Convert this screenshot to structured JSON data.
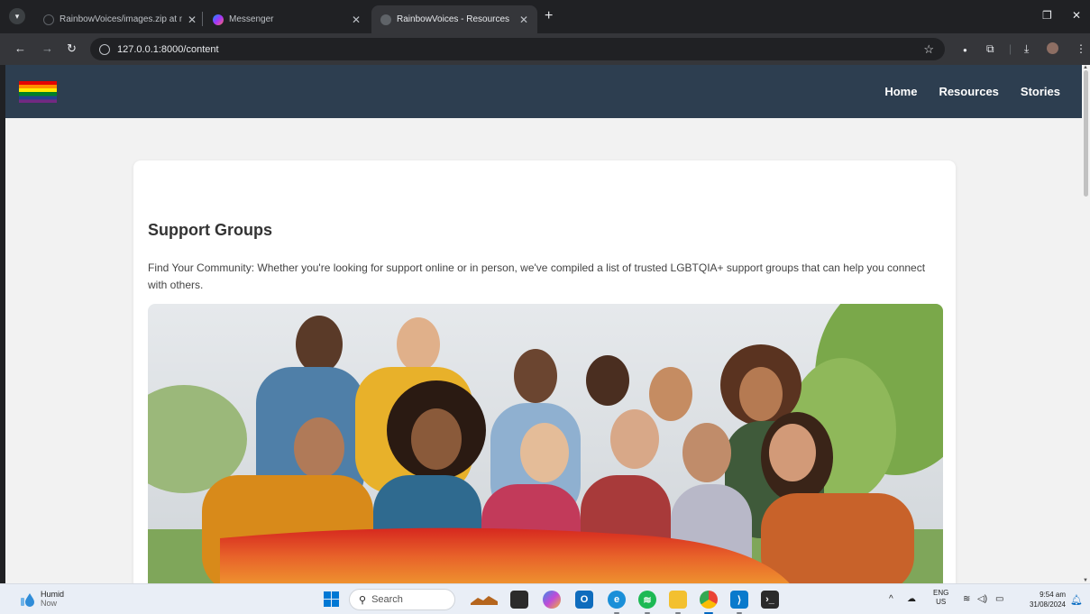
{
  "browser": {
    "tabs": [
      {
        "title": "RainbowVoices/images.zip at m",
        "active": false
      },
      {
        "title": "Messenger",
        "active": false
      },
      {
        "title": "RainbowVoices - Resources",
        "active": true
      }
    ],
    "url": "127.0.0.1:8000/content",
    "icons": [
      "tab-search-icon",
      "close-icon",
      "new-tab-icon",
      "minimize-icon",
      "restore-icon",
      "back-icon",
      "forward-icon",
      "reload-icon",
      "site-info-icon",
      "bookmark-star-icon",
      "extensions-icon",
      "downloads-icon",
      "profile-avatar",
      "menu-icon"
    ]
  },
  "site": {
    "nav": {
      "home": "Home",
      "resources": "Resources",
      "stories": "Stories"
    },
    "section": {
      "heading": "Support Groups",
      "text": "Find Your Community: Whether you're looking for support online or in person, we've compiled a list of trusted LGBTQIA+ support groups that can help you connect with others."
    },
    "colors": {
      "header_bg": "#2d3e50",
      "page_bg": "#f2f2f2",
      "card_bg": "#ffffff"
    }
  },
  "taskbar": {
    "weather": {
      "line1": "Humid",
      "line2": "Now"
    },
    "search_placeholder": "Search",
    "apps": [
      "file-explorer",
      "copilot",
      "outlook",
      "edge",
      "spotify",
      "folders",
      "chrome",
      "vscode",
      "terminal"
    ],
    "language": {
      "line1": "ENG",
      "line2": "US"
    },
    "clock": {
      "time": "9:54 am",
      "date": "31/08/2024"
    }
  }
}
